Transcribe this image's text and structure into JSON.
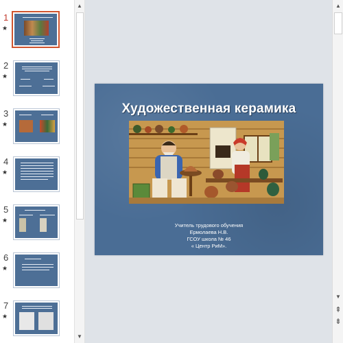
{
  "thumbnails": [
    {
      "num": "1",
      "star": "★",
      "selected": true
    },
    {
      "num": "2",
      "star": "★",
      "selected": false
    },
    {
      "num": "3",
      "star": "★",
      "selected": false
    },
    {
      "num": "4",
      "star": "★",
      "selected": false
    },
    {
      "num": "5",
      "star": "★",
      "selected": false
    },
    {
      "num": "6",
      "star": "★",
      "selected": false
    },
    {
      "num": "7",
      "star": "★",
      "selected": false
    }
  ],
  "scrollbar": {
    "up_glyph": "▲",
    "down_glyph": "▼",
    "prev_slide_glyph": "⇞",
    "next_slide_glyph": "⇟"
  },
  "slide": {
    "title": "Художественная керамика",
    "subtitle_lines": [
      "Учитель трудового обучения",
      "Ермолаева Н.В.",
      "ГСОУ школа № 46",
      "« Центр РиМ»."
    ],
    "image_icon": "potter-workshop-illustration"
  },
  "colors": {
    "slide_bg": "#4a6d95",
    "selected_border": "#d0542e",
    "selected_number": "#c0392b",
    "editor_bg": "#dfe3e8"
  }
}
